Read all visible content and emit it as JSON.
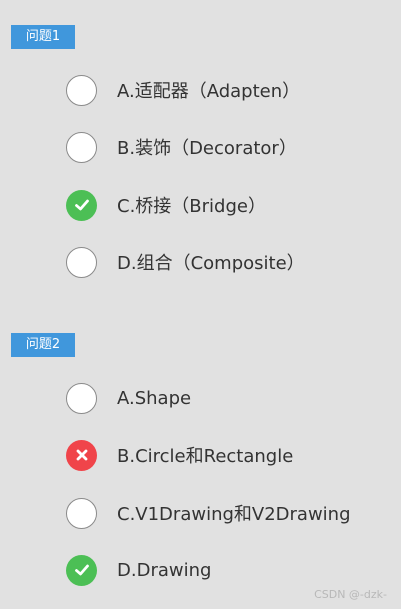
{
  "questions": [
    {
      "header": "问题1",
      "options": [
        {
          "text": "A.适配器（Adapten）",
          "state": "unselected",
          "icon": "empty-radio-icon"
        },
        {
          "text": "B.装饰（Decorator）",
          "state": "unselected",
          "icon": "empty-radio-icon"
        },
        {
          "text": "C.桥接（Bridge）",
          "state": "correct",
          "icon": "checkmark-icon"
        },
        {
          "text": "D.组合（Composite）",
          "state": "unselected",
          "icon": "empty-radio-icon"
        }
      ]
    },
    {
      "header": "问题2",
      "options": [
        {
          "text": "A.Shape",
          "state": "unselected",
          "icon": "empty-radio-icon"
        },
        {
          "text": "B.Circle和Rectangle",
          "state": "wrong",
          "icon": "cross-icon"
        },
        {
          "text": "C.V1Drawing和V2Drawing",
          "state": "unselected",
          "icon": "empty-radio-icon"
        },
        {
          "text": "D.Drawing",
          "state": "correct",
          "icon": "checkmark-icon"
        }
      ]
    }
  ],
  "watermark": "CSDN @-dzk-",
  "colors": {
    "header_bg": "#4097dc",
    "correct": "#4cbf55",
    "wrong": "#f0444a",
    "background": "#e1e1e1"
  }
}
